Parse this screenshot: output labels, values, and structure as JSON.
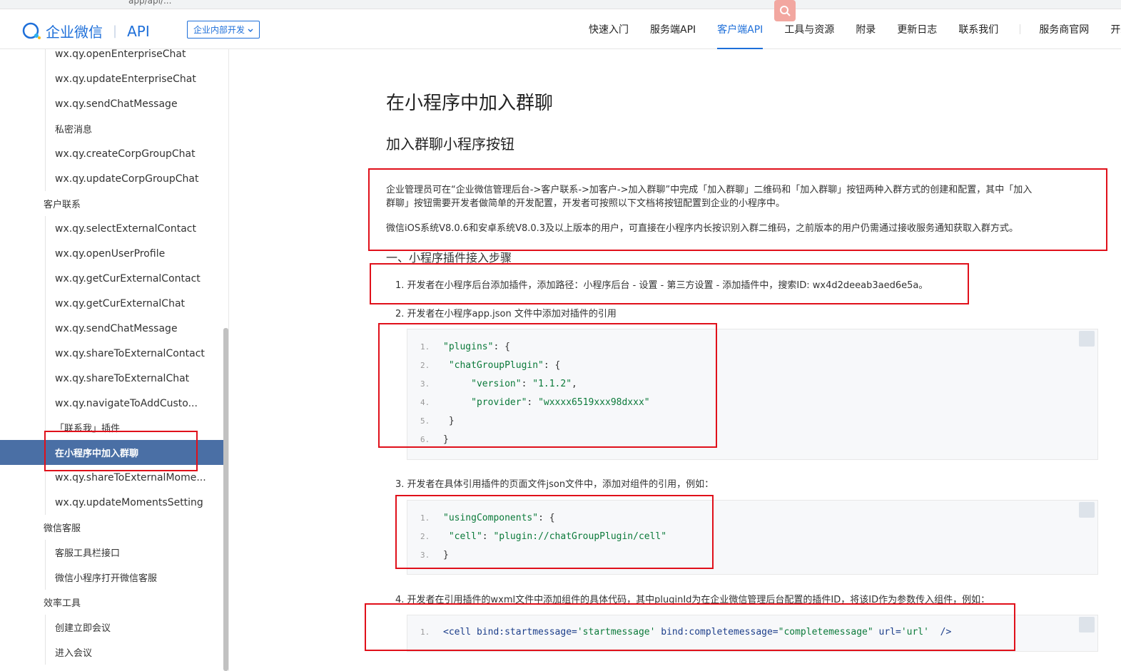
{
  "browser": {
    "url_fragment": "app/api/..."
  },
  "header": {
    "logo_text": "企业微信",
    "logo_api": "API",
    "dropdown_label": "企业内部开发",
    "nav": [
      "快速入门",
      "服务端API",
      "客户端API",
      "工具与资源",
      "附录",
      "更新日志",
      "联系我们",
      "服务商官网",
      "开发"
    ],
    "active_nav": "客户端API"
  },
  "sidebar": {
    "items": [
      {
        "label": "wx.qy.openEnterpriseChat",
        "kind": "sub"
      },
      {
        "label": "wx.qy.updateEnterpriseChat",
        "kind": "sub"
      },
      {
        "label": "wx.qy.sendChatMessage",
        "kind": "sub"
      },
      {
        "label": "私密消息",
        "kind": "sub"
      },
      {
        "label": "wx.qy.createCorpGroupChat",
        "kind": "sub"
      },
      {
        "label": "wx.qy.updateCorpGroupChat",
        "kind": "sub"
      },
      {
        "label": "客户联系",
        "kind": "group"
      },
      {
        "label": "wx.qy.selectExternalContact",
        "kind": "sub"
      },
      {
        "label": "wx.qy.openUserProfile",
        "kind": "sub"
      },
      {
        "label": "wx.qy.getCurExternalContact",
        "kind": "sub"
      },
      {
        "label": "wx.qy.getCurExternalChat",
        "kind": "sub"
      },
      {
        "label": "wx.qy.sendChatMessage",
        "kind": "sub"
      },
      {
        "label": "wx.qy.shareToExternalContact",
        "kind": "sub"
      },
      {
        "label": "wx.qy.shareToExternalChat",
        "kind": "sub"
      },
      {
        "label": "wx.qy.navigateToAddCusto...",
        "kind": "sub"
      },
      {
        "label": "「联系我」插件",
        "kind": "sub"
      },
      {
        "label": "在小程序中加入群聊",
        "kind": "active"
      },
      {
        "label": "wx.qy.shareToExternalMome...",
        "kind": "sub"
      },
      {
        "label": "wx.qy.updateMomentsSetting",
        "kind": "sub"
      },
      {
        "label": "微信客服",
        "kind": "group"
      },
      {
        "label": "客服工具栏接口",
        "kind": "sub"
      },
      {
        "label": "微信小程序打开微信客服",
        "kind": "sub"
      },
      {
        "label": "效率工具",
        "kind": "group"
      },
      {
        "label": "创建立即会议",
        "kind": "sub"
      },
      {
        "label": "进入会议",
        "kind": "sub"
      }
    ]
  },
  "content": {
    "title": "在小程序中加入群聊",
    "subtitle": "加入群聊小程序按钮",
    "intro_line1": "企业管理员可在“企业微信管理后台->客户联系->加客户->加入群聊”中完成「加入群聊」二维码和「加入群聊」按钮两种入群方式的创建和配置，其中「加入",
    "intro_line2": "群聊」按钮需要开发者做简单的开发配置，开发者可按照以下文档将按钮配置到企业的小程序中。",
    "intro_line3": "微信iOS系统V8.0.6和安卓系统V8.0.3及以上版本的用户，可直接在小程序内长按识别入群二维码，之前版本的用户仍需通过接收服务通知获取入群方式。",
    "section_heading": "一、小程序插件接入步骤",
    "step1": "1. 开发者在小程序后台添加插件，添加路径：小程序后台 - 设置 - 第三方设置 - 添加插件中，搜索ID: wx4d2deeab3aed6e5a。",
    "step2": "2. 开发者在小程序app.json 文件中添加对插件的引用",
    "step3": "3. 开发者在具体引用插件的页面文件json文件中，添加对组件的引用，例如：",
    "step4": "4. 开发者在引用插件的wxml文件中添加组件的具体代码，其中pluginId为在企业微信管理后台配置的插件ID，将该ID作为参数传入组件，例如："
  },
  "code1": {
    "line_numbers": [
      "1.",
      "2.",
      "3.",
      "4.",
      "5.",
      "6."
    ],
    "l1_key": "\"plugins\"",
    "l1_rest": ": {",
    "l2_key": "\"chatGroupPlugin\"",
    "l2_rest": ": {",
    "l3_key": "\"version\"",
    "l3_sep": ": ",
    "l3_val": "\"1.1.2\"",
    "l3_end": ",",
    "l4_key": "\"provider\"",
    "l4_sep": ": ",
    "l4_val": "\"wxxxx6519xxx98dxxx\"",
    "l5": "}",
    "l6": "}"
  },
  "code2": {
    "line_numbers": [
      "1.",
      "2.",
      "3."
    ],
    "l1_key": "\"usingComponents\"",
    "l1_rest": ": {",
    "l2_key": "\"cell\"",
    "l2_sep": ": ",
    "l2_val": "\"plugin://chatGroupPlugin/cell\"",
    "l3": "}"
  },
  "code3": {
    "line_numbers": [
      "1."
    ],
    "t_open": "<cell ",
    "a1": "bind:startmessage=",
    "v1": "'startmessage'",
    "a2": " bind:completemessage=",
    "v2": "\"completemessage\"",
    "a3": " url=",
    "v3": "'url'",
    "t_close": "  />"
  },
  "colors": {
    "brand": "#1e6fd9",
    "active_sidebar": "#4a6fa5",
    "annotation": "#e0101a"
  }
}
